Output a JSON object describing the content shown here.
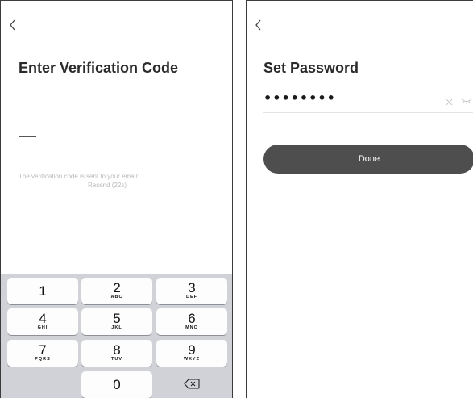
{
  "verify_screen": {
    "title": "Enter Verification Code",
    "code_slot_count": 6,
    "info_text": "The verification code is sent to your email:",
    "resend_label": "Resend (22s)",
    "keypad": [
      {
        "digit": "1",
        "letters": ""
      },
      {
        "digit": "2",
        "letters": "ABC"
      },
      {
        "digit": "3",
        "letters": "DEF"
      },
      {
        "digit": "4",
        "letters": "GHI"
      },
      {
        "digit": "5",
        "letters": "JKL"
      },
      {
        "digit": "6",
        "letters": "MNO"
      },
      {
        "digit": "7",
        "letters": "PQRS"
      },
      {
        "digit": "8",
        "letters": "TUV"
      },
      {
        "digit": "9",
        "letters": "WXYZ"
      },
      {
        "digit": "0",
        "letters": ""
      }
    ]
  },
  "password_screen": {
    "title": "Set Password",
    "password_value": "••••••••",
    "done_label": "Done"
  },
  "icons": {
    "back": "chevron-left-icon",
    "clear": "close-icon",
    "visibility": "eye-off-icon",
    "backspace": "backspace-icon"
  },
  "colors": {
    "button_bg": "#4e4e4e",
    "keypad_bg": "#d0d2d7",
    "hint_text": "#b9b9b9"
  }
}
